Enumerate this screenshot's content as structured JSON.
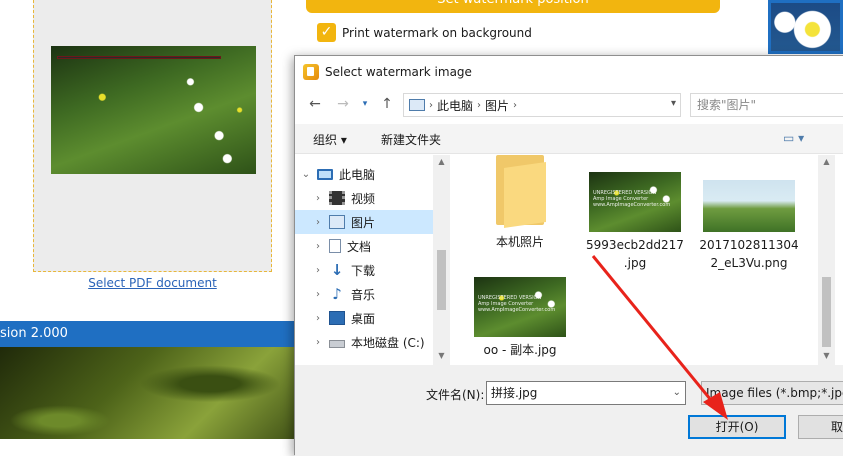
{
  "background_app": {
    "watermark_button_label": "Set watermark position",
    "print_bg_label": "Print watermark on background",
    "print_bg_checked": "✓",
    "select_pdf_link": "Select PDF document",
    "version_text": "sion 2.000"
  },
  "dialog": {
    "title": "Select watermark image",
    "nav": {
      "back_icon": "arrow-left",
      "forward_icon": "arrow-right",
      "recent_icon": "chevron-down",
      "up_icon": "arrow-up"
    },
    "breadcrumb": [
      "此电脑",
      "图片"
    ],
    "search_placeholder": "搜索\"图片\"",
    "toolbar": {
      "organize_label": "组织 ▾",
      "new_folder_label": "新建文件夹"
    },
    "nav_pane": {
      "root": "此电脑",
      "items": [
        {
          "label": "视频",
          "icon": "video-icon"
        },
        {
          "label": "图片",
          "icon": "pictures-icon",
          "selected": true
        },
        {
          "label": "文档",
          "icon": "document-icon"
        },
        {
          "label": "下载",
          "icon": "download-icon"
        },
        {
          "label": "音乐",
          "icon": "music-icon"
        },
        {
          "label": "桌面",
          "icon": "desktop-icon"
        },
        {
          "label": "本地磁盘 (C:)",
          "icon": "disk-icon"
        }
      ]
    },
    "files": [
      {
        "name": "本机照片",
        "kind": "folder"
      },
      {
        "name": "5993ecb2dd217.jpg",
        "line1": "5993ecb2dd217",
        "line2": ".jpg",
        "kind": "image"
      },
      {
        "name": "20171028113042_eL3Vu.png",
        "line1": "2017102811304",
        "line2": "2_eL3Vu.png",
        "kind": "image"
      },
      {
        "name": "oo - 副本.jpg",
        "kind": "image"
      }
    ],
    "thumb_watermark_text": "UNREGISTERED VERSION\nAmp Image Converter\nwww.AmpImageConverter.com",
    "filename_label": "文件名(N):",
    "filename_value": "拼接.jpg",
    "filter_value": "Image files (*.bmp;*.jpg;",
    "open_label": "打开(O)",
    "cancel_label": "取"
  },
  "colors": {
    "accent_yellow": "#f2b50f",
    "dialog_selection": "#cce8ff",
    "primary_blue": "#1f6fc2",
    "annotation_red": "#e8231b"
  }
}
